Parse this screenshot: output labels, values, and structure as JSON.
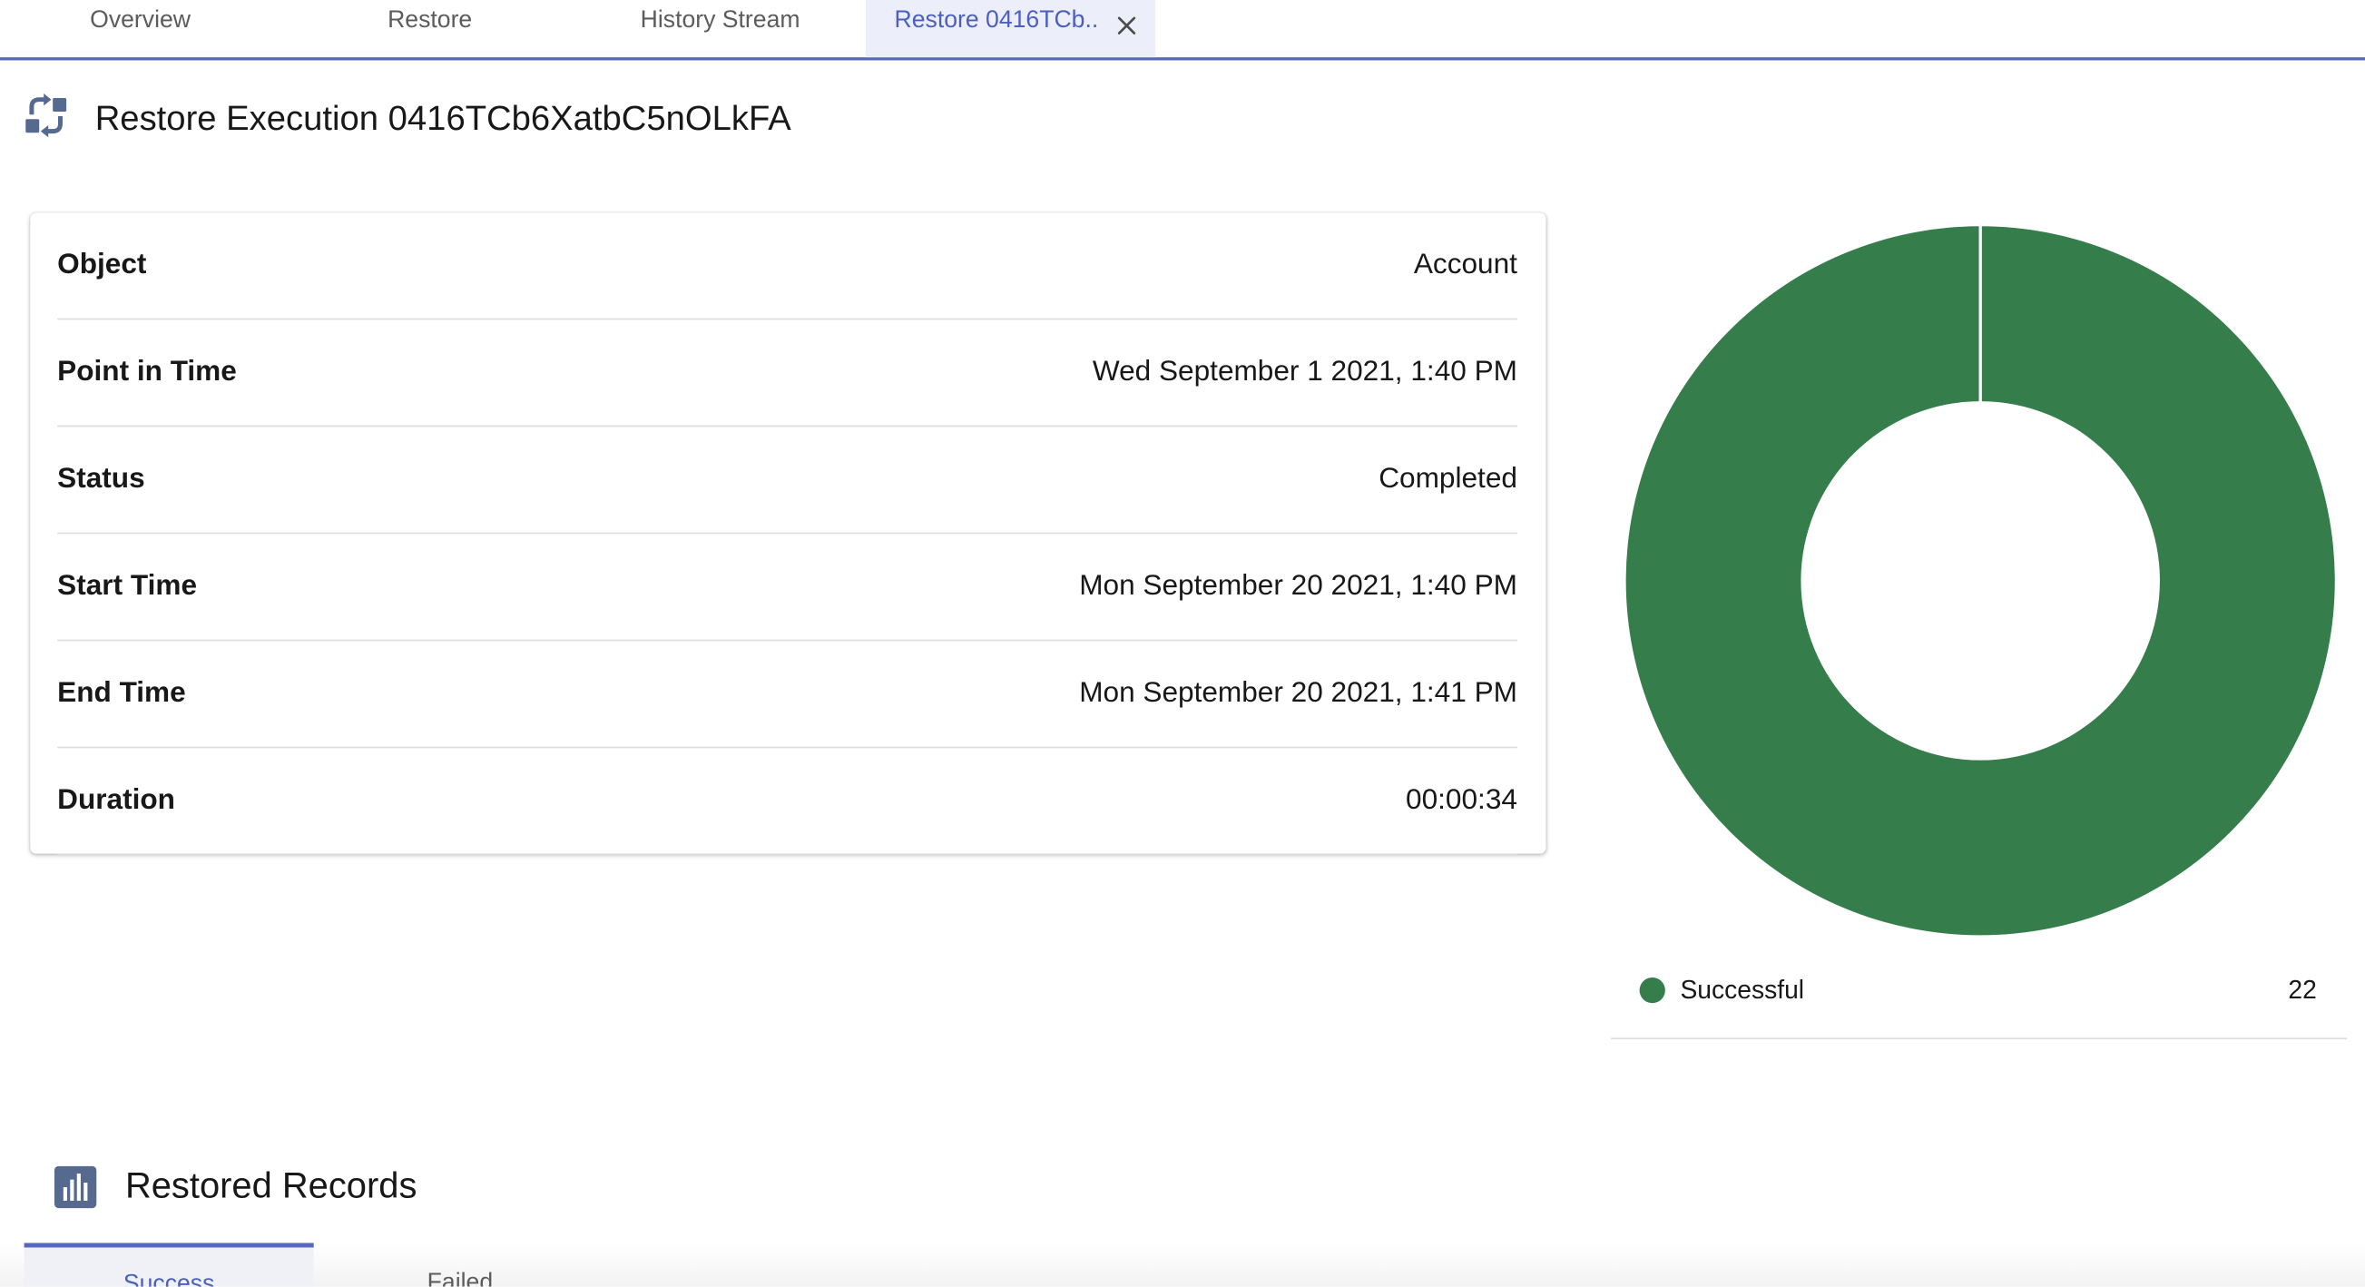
{
  "tabs": [
    {
      "label": "Overview"
    },
    {
      "label": "Restore"
    },
    {
      "label": "History Stream"
    },
    {
      "label": "Restore 0416TCb..",
      "active": true
    }
  ],
  "header": {
    "title": "Restore Execution 0416TCb6XatbC5nOLkFA",
    "icon": "restore-swap-icon"
  },
  "details": [
    {
      "label": "Object",
      "value": "Account"
    },
    {
      "label": "Point in Time",
      "value": "Wed September 1 2021, 1:40 PM"
    },
    {
      "label": "Status",
      "value": "Completed"
    },
    {
      "label": "Start Time",
      "value": "Mon September 20 2021, 1:40 PM"
    },
    {
      "label": "End Time",
      "value": "Mon September 20 2021, 1:41 PM"
    },
    {
      "label": "Duration",
      "value": "00:00:34"
    }
  ],
  "chart_data": {
    "type": "pie",
    "donut": true,
    "categories": [
      "Successful"
    ],
    "values": [
      22
    ],
    "colors": [
      "#367d4c"
    ],
    "legend": "bottom"
  },
  "section": {
    "title": "Restored Records",
    "icon": "bar-chart-icon",
    "tabs": [
      {
        "label": "Success",
        "active": true
      },
      {
        "label": "Failed"
      }
    ]
  },
  "colors": {
    "accent": "#5867c0",
    "success": "#367d4c"
  }
}
